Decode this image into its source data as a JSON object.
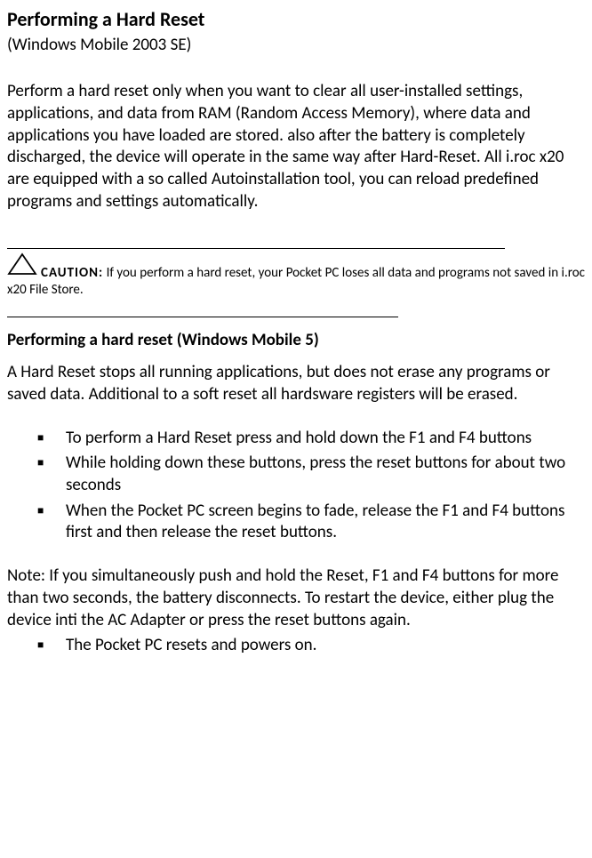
{
  "title": "Performing a Hard Reset",
  "subtitle": "(Windows Mobile 2003 SE)",
  "intro": "Perform a hard reset only when you want to clear all user-installed settings, applications, and data from RAM (Random Access Memory), where data and applications you have loaded are stored. also after the battery is completely discharged, the device will operate in the same way after Hard-Reset. All i.roc x20 are equipped with a so called Autoinstallation tool, you can reload predefined programs and settings automatically.",
  "caution": {
    "label": "CAUTION:",
    "text": " If you perform a hard reset, your Pocket PC loses all data and programs not saved in i.roc x20 File Store."
  },
  "section2": {
    "title": "Performing a hard reset (Windows Mobile 5)",
    "para": "A Hard Reset stops all running applications, but does not erase any programs or saved data. Additional to a soft reset all hardsware registers will be erased.",
    "steps": [
      "To perform  a Hard Reset press and hold down the F1 and F4 buttons",
      "While holding down these buttons, press the reset buttons for about two seconds",
      "When the Pocket PC screen begins to fade, release the F1 and F4 buttons first and then release the reset buttons."
    ],
    "note": "Note: If you simultaneously push and hold the Reset, F1 and F4 buttons for more than two seconds, the battery disconnects. To restart the device, either plug the device inti the AC Adapter or press the reset buttons again.",
    "note_bullet": "The Pocket PC resets and powers on."
  }
}
